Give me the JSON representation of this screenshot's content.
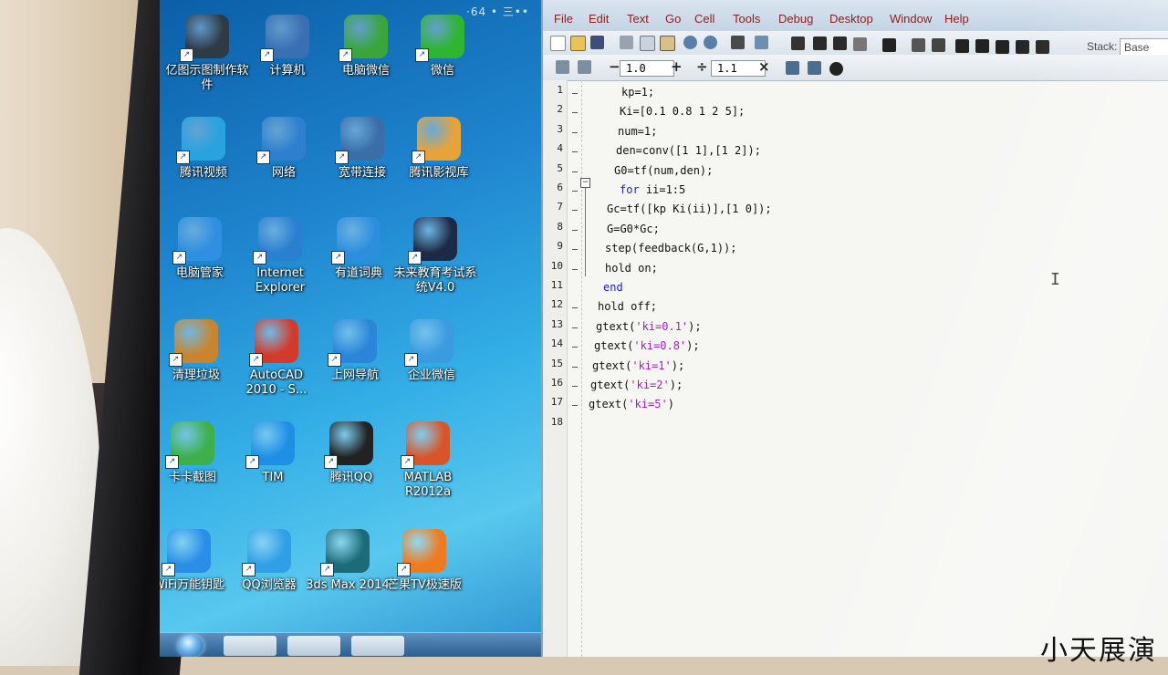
{
  "desktop": {
    "top_text": "·64 • 三••",
    "icons": [
      {
        "label": "亿图示图制作软件",
        "icon": "flowchart-icon",
        "color": "#2e3a44"
      },
      {
        "label": "计算机",
        "icon": "computer-icon",
        "color": "#3a6fb3"
      },
      {
        "label": "电脑微信",
        "icon": "wechat-pc-icon",
        "color": "#3aa63a"
      },
      {
        "label": "微信",
        "icon": "wechat-icon",
        "color": "#2fb52f"
      },
      {
        "label": "腾讯视频",
        "icon": "tencent-video-icon",
        "color": "#27a3e0"
      },
      {
        "label": "网络",
        "icon": "network-globe-icon",
        "color": "#2f7fcf"
      },
      {
        "label": "宽带连接",
        "icon": "broadband-icon",
        "color": "#3b6ea9"
      },
      {
        "label": "腾讯影视库",
        "icon": "folder-video-icon",
        "color": "#e8a338"
      },
      {
        "label": "电脑管家",
        "icon": "pc-manager-shield-icon",
        "color": "#2f8fe0"
      },
      {
        "label": "Internet Explorer",
        "icon": "internet-explorer-icon",
        "color": "#2a7fd0"
      },
      {
        "label": "有道词典",
        "icon": "youdao-dictionary-icon",
        "color": "#2e8ede"
      },
      {
        "label": "未来教育考试系统V4.0",
        "icon": "exam-system-icon",
        "color": "#1d2a46"
      },
      {
        "label": "清理垃圾",
        "icon": "broom-icon",
        "color": "#c9852e"
      },
      {
        "label": "AutoCAD 2010 - S...",
        "icon": "autocad-icon",
        "color": "#d23b2b"
      },
      {
        "label": "上网导航",
        "icon": "ie-navigation-icon",
        "color": "#2a86d8"
      },
      {
        "label": "企业微信",
        "icon": "wecom-icon",
        "color": "#3b9be0"
      },
      {
        "label": "卡卡截图",
        "icon": "feather-screenshot-icon",
        "color": "#3db04a"
      },
      {
        "label": "TIM",
        "icon": "tim-star-icon",
        "color": "#1f8fe6"
      },
      {
        "label": "腾讯QQ",
        "icon": "qq-penguin-icon",
        "color": "#222222"
      },
      {
        "label": "MATLAB R2012a",
        "icon": "matlab-icon",
        "color": "#d8552a"
      },
      {
        "label": "WiFi万能钥匙",
        "icon": "wifi-key-icon",
        "color": "#2a8ee6"
      },
      {
        "label": "QQ浏览器",
        "icon": "qq-browser-icon",
        "color": "#2f9fe6"
      },
      {
        "label": "3ds Max 2014",
        "icon": "3ds-max-icon",
        "color": "#1c6b78"
      },
      {
        "label": "芒果TV极速版",
        "icon": "mango-tv-icon",
        "color": "#f07a1e"
      }
    ]
  },
  "editor": {
    "menu": [
      "File",
      "Edit",
      "Text",
      "Go",
      "Cell",
      "Tools",
      "Debug",
      "Desktop",
      "Window",
      "Help"
    ],
    "cell_toolbar": {
      "decrement": "−",
      "value1": "1.0",
      "increment": "+",
      "divide": "÷",
      "value2": "1.1",
      "close": "×"
    },
    "stack": {
      "label": "Stack:",
      "value": "Base"
    },
    "line_numbers": [
      "1",
      "2",
      "3",
      "4",
      "5",
      "6",
      "7",
      "8",
      "9",
      "10",
      "11",
      "12",
      "13",
      "14",
      "15",
      "16",
      "17",
      "18"
    ],
    "code": [
      "kp=1;",
      "Ki=[0.1 0.8 1 2 5];",
      "num=1;",
      "den=conv([1 1],[1 2]);",
      "G0=tf(num,den);",
      "for ii=1:5",
      "Gc=tf([kp Ki(ii)],[1 0]);",
      "G=G0*Gc;",
      "step(feedback(G,1));",
      "hold on;",
      "end",
      "hold off;",
      "gtext('ki=0.1');",
      "gtext('ki=0.8');",
      "gtext('ki=1');",
      "gtext('ki=2');",
      "gtext('ki=5')",
      ""
    ],
    "fold_symbol": "−",
    "cursor_glyph": "I"
  },
  "overlay": {
    "caption": "小天展演"
  },
  "colors": {
    "keyword": "#1a1af0",
    "string": "#a020c8",
    "menu_text": "#8a1f1f"
  }
}
